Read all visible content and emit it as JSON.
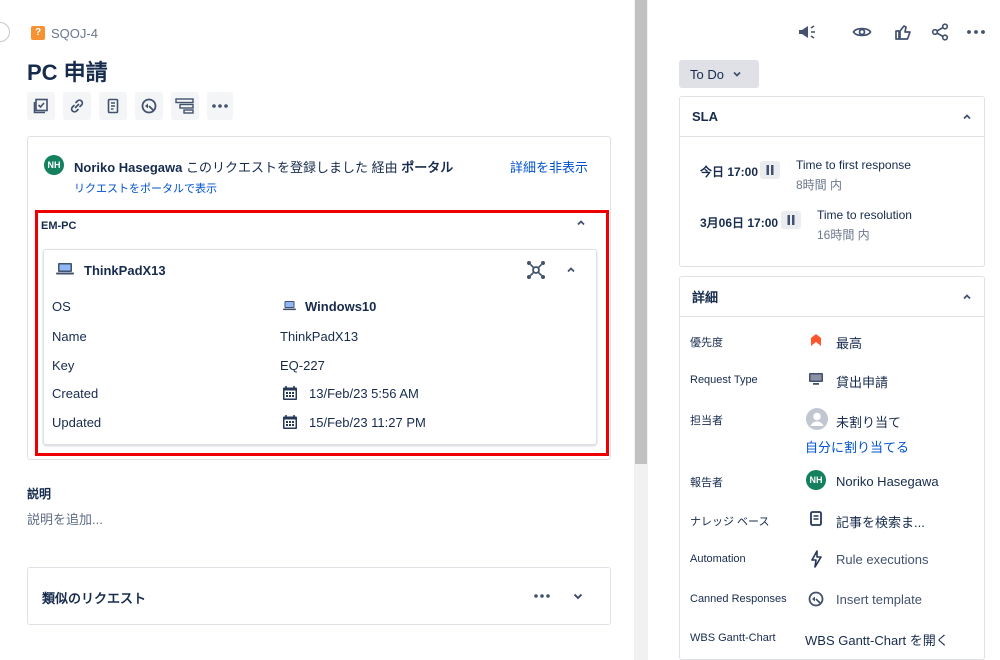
{
  "issue": {
    "key": "SQOJ-4",
    "type_glyph": "?",
    "title": "PC 申請"
  },
  "activity": {
    "avatar_initials": "NH",
    "reporter_name": "Noriko Hasegawa",
    "action_text": "このリクエストを登録しました 経由",
    "channel": "ポータル",
    "hide_details": "詳細を非表示",
    "view_in_portal": "リクエストをポータルで表示"
  },
  "asset_field": {
    "label": "EM-PC",
    "object_name": "ThinkPadX13",
    "rows": [
      {
        "label": "OS",
        "value": "Windows10",
        "is_link": true
      },
      {
        "label": "Name",
        "value": "ThinkPadX13"
      },
      {
        "label": "Key",
        "value": "EQ-227"
      },
      {
        "label": "Created",
        "value": "13/Feb/23 5:56 AM"
      },
      {
        "label": "Updated",
        "value": "15/Feb/23 11:27 PM"
      }
    ]
  },
  "description": {
    "label": "説明",
    "placeholder": "説明を追加..."
  },
  "similar": {
    "label": "類似のリクエスト"
  },
  "status": {
    "label": "To Do"
  },
  "sla": {
    "title": "SLA",
    "items": [
      {
        "time": "今日 17:00",
        "name": "Time to first response",
        "remaining": "8時間 内"
      },
      {
        "time": "3月06日 17:00",
        "name": "Time to resolution",
        "remaining": "16時間 内"
      }
    ]
  },
  "details": {
    "title": "詳細",
    "fields": [
      {
        "label": "優先度",
        "value": "最高",
        "icon": "priority-highest-icon"
      },
      {
        "label": "Request Type",
        "value": "貸出申請",
        "icon": "monitor-icon"
      },
      {
        "label": "担当者",
        "value": "未割り当て",
        "icon": "user-avatar-icon",
        "action": "自分に割り当てる"
      },
      {
        "label": "報告者",
        "value": "Noriko Hasegawa",
        "icon": "avatar-nh",
        "avatar_initials": "NH"
      },
      {
        "label": "ナレッジ ベース",
        "value": "記事を検索ま...",
        "icon": "article-icon"
      },
      {
        "label": "Automation",
        "value": "Rule executions",
        "icon": "lightning-icon"
      },
      {
        "label": "Canned Responses",
        "value": "Insert template",
        "icon": "canned-icon"
      },
      {
        "label": "WBS Gantt-Chart",
        "value": "WBS Gantt-Chart を開く",
        "icon": ""
      }
    ]
  },
  "colors": {
    "brand_blue": "#0052cc",
    "priority_red": "#ff5630",
    "avatar_green": "#14805e",
    "highlight_red": "#e00000"
  }
}
